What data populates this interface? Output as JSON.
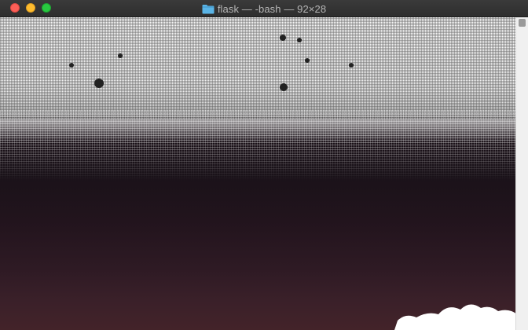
{
  "window": {
    "title": "flask — -bash — 92×28",
    "title_icon": "folder-icon",
    "controls": [
      "close",
      "minimize",
      "zoom"
    ]
  },
  "colors": {
    "titlebar": "#2f2f2f",
    "title_text": "#b6b6b6",
    "folder": "#5ab4e6",
    "close": "#fc5f57",
    "minimize": "#febc2e",
    "zoom": "#28c840"
  }
}
